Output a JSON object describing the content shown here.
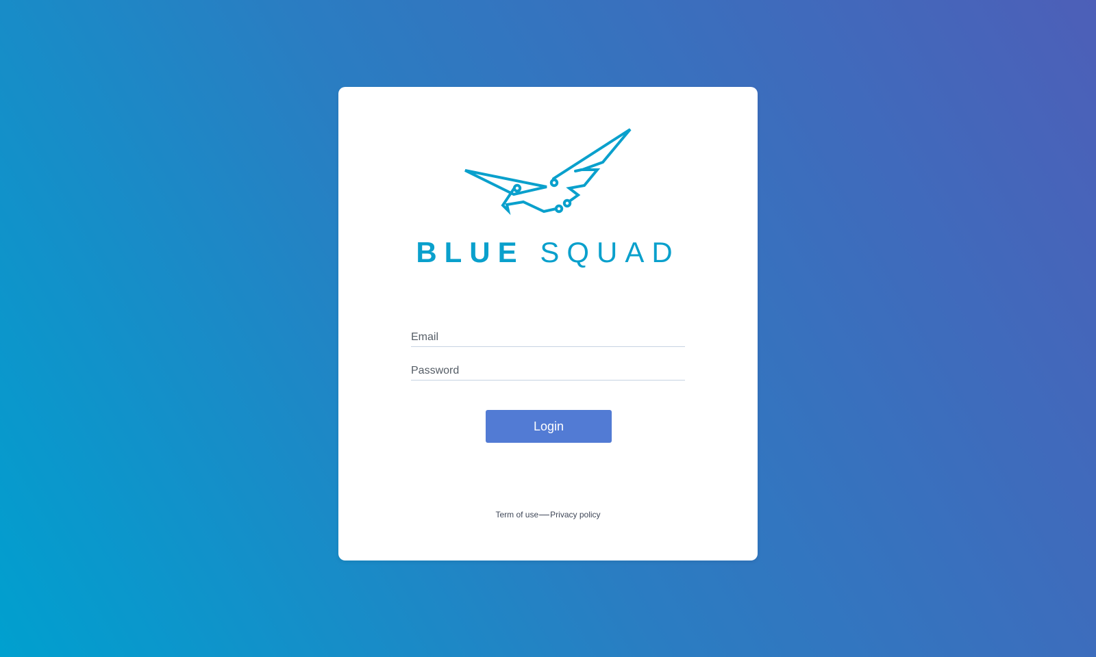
{
  "colors": {
    "background_start": "#00a0cf",
    "background_end": "#4d5fb8",
    "brand": "#0aa0cc",
    "button": "#527bd4",
    "card": "#ffffff"
  },
  "logo": {
    "icon": "eagle-icon",
    "brand_word_1": "BLUE",
    "brand_word_2": "SQUAD"
  },
  "form": {
    "email_placeholder": "Email",
    "email_value": "",
    "password_placeholder": "Password",
    "password_value": "",
    "login_label": "Login"
  },
  "footer": {
    "terms_label": "Term of use",
    "privacy_label": "Privacy policy"
  }
}
